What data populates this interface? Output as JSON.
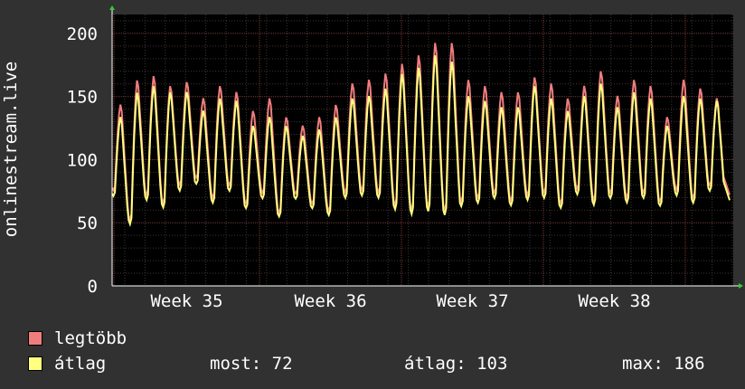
{
  "chart_data": {
    "type": "line",
    "title": "",
    "ylabel": "onlinestream.live",
    "xlabel": "",
    "ylim": [
      0,
      215
    ],
    "y_ticks": [
      "0",
      "50",
      "100",
      "150",
      "200"
    ],
    "x_tick_labels": [
      "Week 35",
      "Week 36",
      "Week 37",
      "Week 38"
    ],
    "grid": true,
    "series": [
      {
        "name": "legtöbb",
        "color": "#f07d7d",
        "peaks": [
          145,
          165,
          168,
          160,
          163,
          150,
          160,
          155,
          140,
          150,
          135,
          128,
          135,
          145,
          162,
          165,
          170,
          178,
          185,
          195,
          195,
          165,
          160,
          155,
          155,
          167,
          162,
          150,
          160,
          172,
          152,
          165,
          160,
          135,
          165,
          158,
          150
        ]
      },
      {
        "name": "átlag",
        "color": "#ffff80",
        "peaks": [
          135,
          155,
          160,
          155,
          155,
          140,
          150,
          148,
          128,
          135,
          128,
          120,
          125,
          135,
          150,
          152,
          158,
          170,
          175,
          185,
          180,
          152,
          148,
          143,
          143,
          160,
          150,
          140,
          152,
          162,
          143,
          155,
          150,
          128,
          152,
          150,
          148
        ]
      }
    ],
    "troughs": [
      72,
      48,
      68,
      62,
      76,
      82,
      66,
      76,
      62,
      70,
      55,
      70,
      62,
      56,
      70,
      72,
      70,
      60,
      56,
      58,
      55,
      63,
      66,
      70,
      64,
      68,
      70,
      62,
      73,
      64,
      70,
      66,
      70,
      64,
      72,
      66,
      76,
      70
    ]
  },
  "legend": {
    "max_label": "legtöbb",
    "avg_label": "átlag",
    "max_color": "#f07d7d",
    "avg_color": "#ffff80"
  },
  "stats": {
    "current": "most: 72",
    "average": "átlag: 103",
    "maximum": "max: 186"
  }
}
